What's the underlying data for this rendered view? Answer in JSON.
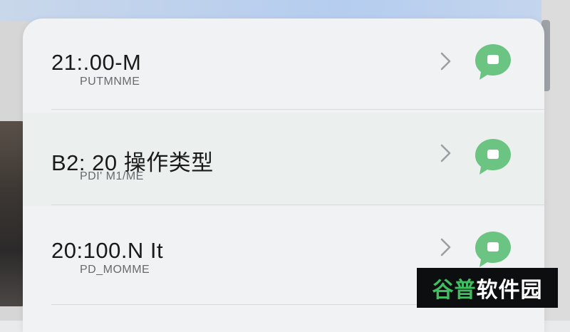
{
  "colors": {
    "accent_green": "#6cc483",
    "card_bg": "#f1f2f3",
    "title_text": "#1a1a1a",
    "subtitle_text": "#666a6e",
    "watermark_green": "#3fbf62"
  },
  "list": {
    "items": [
      {
        "title": "21:.00-M",
        "subtitle": "PUTMNME",
        "chevron_icon": "chevron-right-icon",
        "action_icon": "chat-bubble-icon"
      },
      {
        "title": "B2: 20 操作类型",
        "subtitle": "PDI' M1/ME",
        "chevron_icon": "chevron-right-icon",
        "action_icon": "chat-bubble-icon"
      },
      {
        "title": "20:100.N It",
        "subtitle": "PD_MOMME",
        "chevron_icon": "chevron-right-icon",
        "action_icon": "chat-bubble-icon"
      }
    ]
  },
  "watermark": {
    "part1": "谷普",
    "part2": "软件园"
  }
}
